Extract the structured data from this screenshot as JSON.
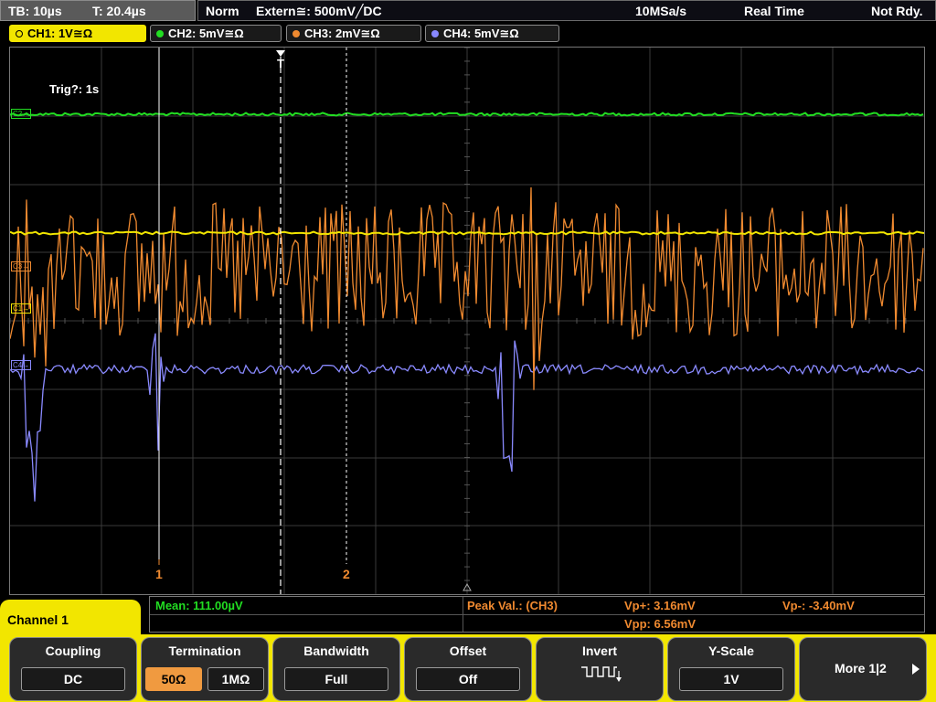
{
  "status": {
    "timebase": "TB: 10µs",
    "trigger_time": "T: 20.4µs",
    "mode": "Norm",
    "trigger": "Extern≅: 500mV╱DC",
    "sample_rate": "10MSa/s",
    "acq_mode": "Real Time",
    "state": "Not Rdy."
  },
  "channels": [
    {
      "label": "CH1: 1V≅Ω",
      "color": "#f2e600",
      "active": true
    },
    {
      "label": "CH2: 5mV≅Ω",
      "color": "#22dd22",
      "active": false
    },
    {
      "label": "CH3: 2mV≅Ω",
      "color": "#f08a30",
      "active": false
    },
    {
      "label": "CH4: 5mV≅Ω",
      "color": "#8888ff",
      "active": false
    }
  ],
  "display": {
    "trig_info": "Trig?: 1s",
    "trigger_marker": "T",
    "cursor1_label": "1",
    "cursor2_label": "2",
    "ch_markers": {
      "c2": "C2→",
      "c3": "C3→",
      "c1": "C1→",
      "c4": "C4→"
    }
  },
  "measurements": {
    "mean": "Mean: 111.00µV",
    "peak_label": "Peak Val.:  (CH3)",
    "vp_plus": "Vp+: 3.16mV",
    "vp_minus": "Vp-: -3.40mV",
    "vpp": "Vpp: 6.56mV"
  },
  "menu": {
    "title": "Channel 1",
    "coupling": {
      "title": "Coupling",
      "value": "DC"
    },
    "termination": {
      "title": "Termination",
      "opt1": "50Ω",
      "opt2": "1MΩ"
    },
    "bandwidth": {
      "title": "Bandwidth",
      "value": "Full"
    },
    "offset": {
      "title": "Offset",
      "value": "Off"
    },
    "invert": {
      "title": "Invert"
    },
    "yscale": {
      "title": "Y-Scale",
      "value": "1V"
    },
    "more": {
      "label": "More 1|2"
    }
  }
}
